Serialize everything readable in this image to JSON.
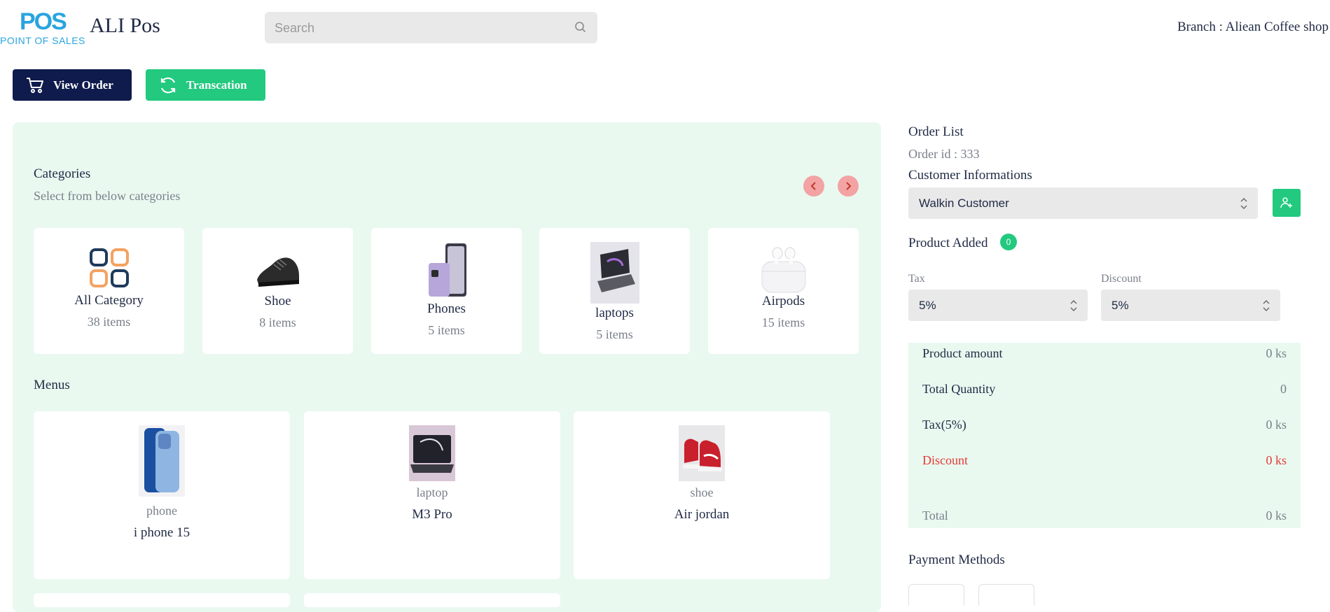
{
  "header": {
    "logo_mark": "POS",
    "logo_text": "POINT OF SALES",
    "app_title": "ALI Pos",
    "search_placeholder": "Search",
    "branch": "Branch : Aliean Coffee shop"
  },
  "actions": {
    "view_order": "View Order",
    "transaction": "Transcation"
  },
  "categories": {
    "title": "Categories",
    "subtitle": "Select from below categories",
    "items": [
      {
        "name": "All Category",
        "count": "38 items",
        "icon": "grid-icon"
      },
      {
        "name": "Shoe",
        "count": "8 items",
        "icon": "shoe-image"
      },
      {
        "name": "Phones",
        "count": "5 items",
        "icon": "phone-image"
      },
      {
        "name": "laptops",
        "count": "5 items",
        "icon": "laptop-image"
      },
      {
        "name": "Airpods",
        "count": "15 items",
        "icon": "airpods-image"
      }
    ]
  },
  "menus": {
    "title": "Menus",
    "items": [
      {
        "kind": "phone",
        "name": "i phone 15",
        "icon": "iphone-image"
      },
      {
        "kind": "laptop",
        "name": "M3 Pro",
        "icon": "laptop-image"
      },
      {
        "kind": "shoe",
        "name": "Air jordan",
        "icon": "sneaker-image"
      }
    ]
  },
  "order": {
    "title": "Order List",
    "order_id": "Order id : 333",
    "customer_label": "Customer Informations",
    "customer_value": "Walkin Customer",
    "product_added_label": "Product Added",
    "product_added_count": "0",
    "tax_label": "Tax",
    "tax_value": "5%",
    "discount_label": "Discount",
    "discount_value": "5%",
    "summary": {
      "product_amount_label": "Product amount",
      "product_amount": "0 ks",
      "total_quantity_label": "Total Quantity",
      "total_quantity": "0",
      "tax_label": "Tax(5%)",
      "tax": "0 ks",
      "discount_label": "Discount",
      "discount": "0 ks",
      "total_label": "Total",
      "total": "0 ks"
    },
    "payment_methods_label": "Payment Methods"
  },
  "colors": {
    "navy": "#0f1b4c",
    "green": "#22c97f",
    "panel_bg": "#e9f9f0",
    "arrow_bg": "#f3a3a3",
    "discount_red": "#e53935",
    "logo_blue": "#2aa4e0"
  }
}
